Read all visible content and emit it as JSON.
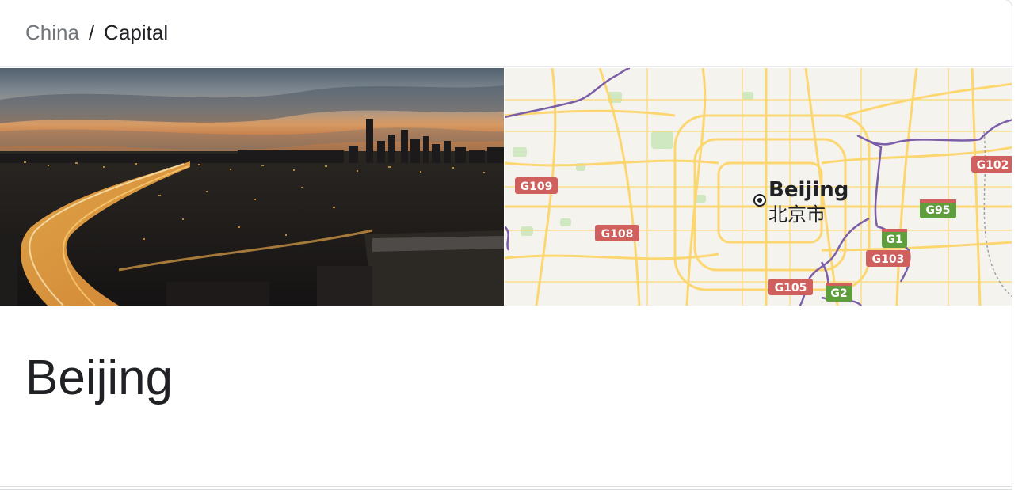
{
  "breadcrumb": {
    "parent": "China",
    "separator": "/",
    "current": "Capital"
  },
  "media": {
    "photo_alt": "Beijing skyline at dusk",
    "map": {
      "city_name": "Beijing",
      "city_name_local": "北京市",
      "road_labels": {
        "g109": "G109",
        "g108": "G108",
        "g105": "G105",
        "g103": "G103",
        "g102": "G102",
        "g95": "G95",
        "g1": "G1",
        "g2": "G2"
      },
      "colors": {
        "national_road": "#d0605e",
        "expressway": "#5f9e3c",
        "boundary": "#7b5ea7",
        "roads": "#fcd771",
        "land": "#f5f3ee"
      }
    }
  },
  "entity": {
    "title": "Beijing"
  }
}
